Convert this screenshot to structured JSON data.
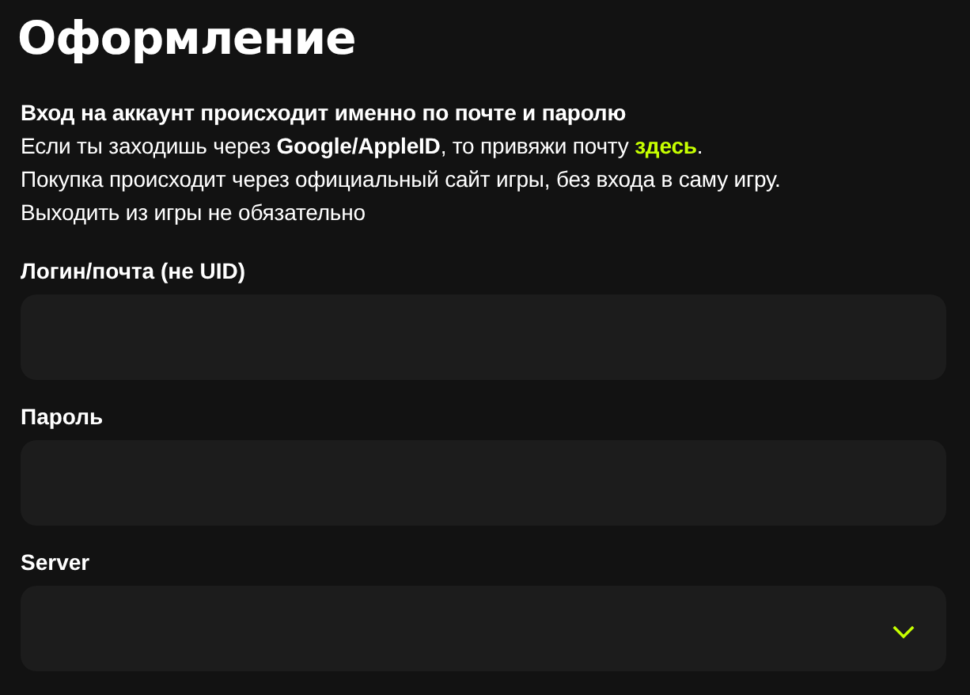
{
  "title": "Оформление",
  "info": [
    {
      "text": "Вход на аккаунт происходит именно по почте и паролю",
      "bold": true
    },
    {
      "text": "Если ты заходишь через **Google/AppleID**, то привяжи почту ",
      "bold": false,
      "link": "здесь",
      "after": "."
    },
    {
      "text": "Покупка происходит через официальный сайт игры, без входа в саму игру.",
      "bold": false
    },
    {
      "text": "Выходить из игры не обязательно",
      "bold": false
    }
  ],
  "fields": [
    {
      "label": "Логин/почта (не UID)",
      "kind": "text"
    },
    {
      "label": "Пароль",
      "kind": "password"
    },
    {
      "label": "Server",
      "kind": "select"
    }
  ]
}
